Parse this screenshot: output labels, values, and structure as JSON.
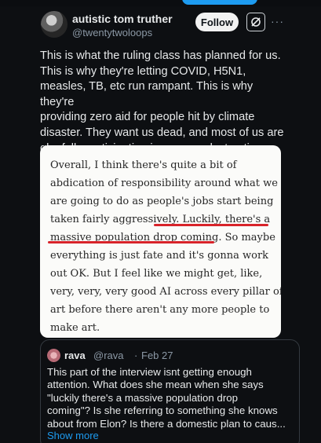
{
  "tweet": {
    "author_name": "autistic tom truther",
    "handle": "@twentytwoloops",
    "follow_label": "Follow",
    "more_icon": "more-horizontal-icon",
    "grok_icon": "grok-icon",
    "text_lines": [
      "This is what the ruling class has planned for us.",
      "This is why they're letting COVID, H5N1,",
      "measles, TB, etc run rampant. This is why they're",
      "providing zero aid for people hit by climate",
      "disaster. They want us dead, and most of us are",
      "gleefully participating in our own destruction"
    ]
  },
  "quote_image": {
    "lines": [
      "Overall, I think there's quite a bit of",
      "abdication of responsibility around what we",
      "are going to do as people's jobs start being",
      "taken fairly aggressively. Luckily, there's a",
      "massive population drop coming. So maybe",
      "everything is just fate and it's gonna work",
      "out OK. But I feel like we might get, like,",
      "very, very, very good AI across every pillar of",
      "art before there aren't any more people to",
      "make art."
    ],
    "highlight_color": "#d8232a"
  },
  "quoted_tweet": {
    "author_name": "rava",
    "handle": "@rava",
    "separator": "·",
    "date": "Feb 27",
    "text_lines": [
      "This part of the interview isnt getting enough",
      "attention. What does she mean when she says",
      "\"luckily there's a massive population drop",
      "coming\"? Is she referring to something she knows",
      "about from Elon? Is there a domestic plan to caus..."
    ],
    "show_more_label": "Show more"
  },
  "colors": {
    "background": "#0d0f12",
    "text_primary": "#e7e9ea",
    "text_secondary": "#8b98a5",
    "link": "#1d9bf0"
  }
}
